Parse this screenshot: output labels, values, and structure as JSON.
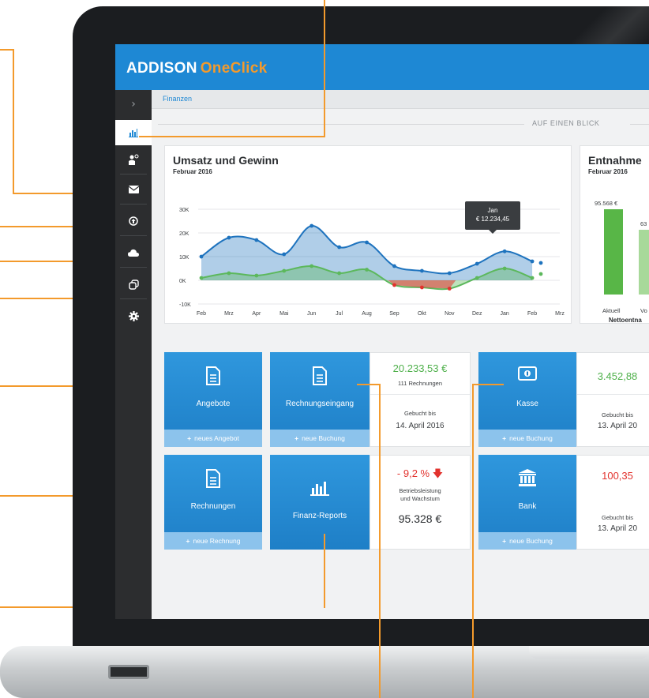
{
  "app": {
    "logo_part1": "ADDISON",
    "logo_part2": "OneClick"
  },
  "breadcrumb": "Finanzen",
  "section_title": "AUF EINEN BLICK",
  "sidebar": {
    "items": [
      {
        "icon": "chevron-right-icon",
        "glyph": "›"
      },
      {
        "icon": "bar-chart-icon",
        "glyph": "▥"
      },
      {
        "icon": "person-settings-icon",
        "glyph": "♟"
      },
      {
        "icon": "envelope-icon",
        "glyph": "✉"
      },
      {
        "icon": "upload-circle-icon",
        "glyph": "⊙"
      },
      {
        "icon": "cloud-icon",
        "glyph": "☁"
      },
      {
        "icon": "copy-icon",
        "glyph": "⧉"
      },
      {
        "icon": "gear-icon",
        "glyph": "⚙"
      }
    ]
  },
  "umsatz_card": {
    "title": "Umsatz und Gewinn",
    "subtitle": "Februar 2016",
    "tooltip_month": "Jan",
    "tooltip_value": "€ 12.234,45"
  },
  "chart_data": {
    "type": "area",
    "title": "Umsatz und Gewinn",
    "subtitle": "Februar 2016",
    "categories": [
      "Feb",
      "Mrz",
      "Apr",
      "Mai",
      "Jun",
      "Jul",
      "Aug",
      "Sep",
      "Okt",
      "Nov",
      "Dez",
      "Jan",
      "Feb",
      "Mrz"
    ],
    "y_ticks": [
      "30K",
      "20K",
      "10K",
      "0K",
      "-10K"
    ],
    "ylim": [
      -10000,
      30000
    ],
    "series": [
      {
        "values": [
          10000,
          18000,
          17000,
          11000,
          23000,
          14000,
          16000,
          6000,
          4000,
          3000,
          7000,
          12234.45,
          8000,
          null
        ],
        "color": "#1e73be"
      },
      {
        "values": [
          1000,
          3000,
          2000,
          4000,
          6000,
          3000,
          4500,
          -2000,
          -3000,
          -3500,
          1000,
          5000,
          1000,
          null
        ],
        "color": "#5cb85c"
      }
    ],
    "grid": true
  },
  "entnahme_card": {
    "title": "Entnahme",
    "subtitle": "Februar 2016",
    "bar1_value": "95.568 €",
    "bar2_value": "63",
    "bar1_label": "Aktuell",
    "bar2_label": "Vo",
    "footer": "Nettoentna"
  },
  "tiles": {
    "angebote": {
      "label": "Angebote",
      "action": "neues Angebot",
      "icon": "document-icon"
    },
    "rechnungseingang": {
      "label": "Rechnungseingang",
      "action": "neue Buchung",
      "icon": "document-icon"
    },
    "kasse": {
      "label": "Kasse",
      "action": "neue Buchung",
      "icon": "cash-icon"
    },
    "rechnungen": {
      "label": "Rechnungen",
      "action": "neue Rechnung",
      "icon": "document-icon"
    },
    "finanz_reports": {
      "label": "Finanz-Reports",
      "icon": "bar-chart-icon"
    },
    "bank": {
      "label": "Bank",
      "action": "neue Buchung",
      "icon": "bank-icon"
    }
  },
  "info_rechnungseingang": {
    "amount": "20.233,53 €",
    "count": "111 Rechnungen",
    "booked_label": "Gebucht bis",
    "booked_date": "14. April 2016"
  },
  "info_kasse": {
    "amount": "3.452,88",
    "booked_label": "Gebucht bis",
    "booked_date": "13. April 20"
  },
  "info_reports": {
    "change": "- 9,2 %",
    "desc_line1": "Betriebsleistung",
    "desc_line2": "und Wachstum",
    "amount": "95.328 €"
  },
  "info_bank": {
    "amount": "100,35",
    "booked_label": "Gebucht bis",
    "booked_date": "13. April 20"
  },
  "colors": {
    "brand": "#1e88d4",
    "accent": "#f39a2c",
    "sidebar": "#2c2d2f",
    "tile_footer": "#8cc3ec",
    "positive": "#4eb04a",
    "negative": "#e2322d"
  }
}
